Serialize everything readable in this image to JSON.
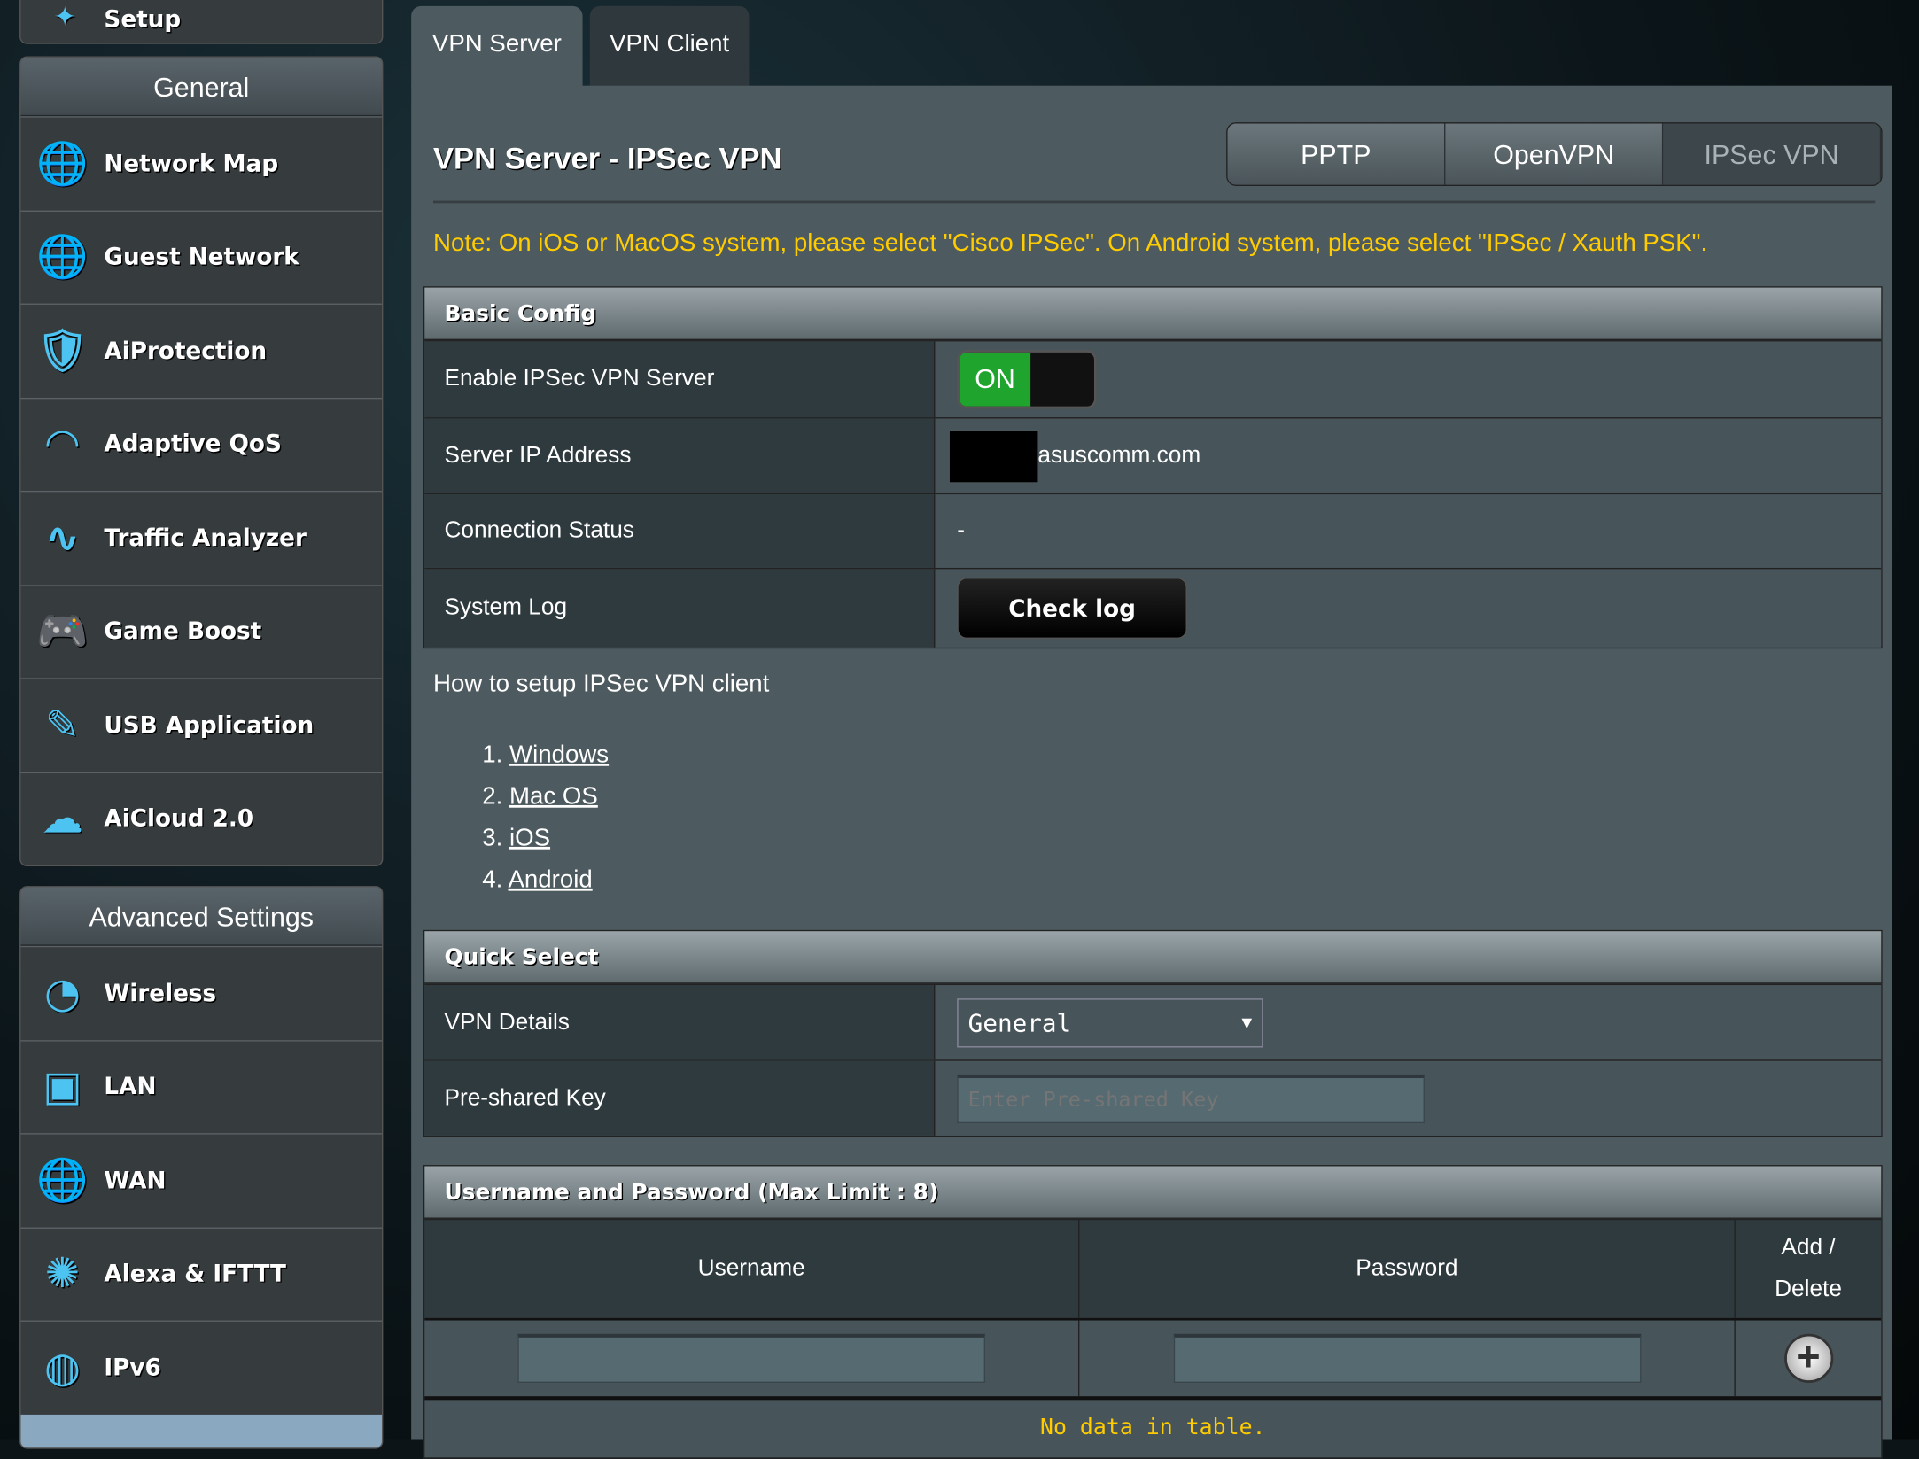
{
  "sidebar": {
    "top_item": "Setup",
    "general": {
      "header": "General",
      "items": [
        {
          "label": "Network Map",
          "icon": "globe-pin-icon"
        },
        {
          "label": "Guest Network",
          "icon": "guest-network-icon"
        },
        {
          "label": "AiProtection",
          "icon": "shield-lock-icon"
        },
        {
          "label": "Adaptive QoS",
          "icon": "speedometer-icon"
        },
        {
          "label": "Traffic Analyzer",
          "icon": "traffic-wave-icon"
        },
        {
          "label": "Game Boost",
          "icon": "gamepad-icon"
        },
        {
          "label": "USB Application",
          "icon": "usb-icon"
        },
        {
          "label": "AiCloud 2.0",
          "icon": "cloud-icon"
        }
      ]
    },
    "advanced": {
      "header": "Advanced Settings",
      "items": [
        {
          "label": "Wireless",
          "icon": "wireless-icon"
        },
        {
          "label": "LAN",
          "icon": "lan-icon"
        },
        {
          "label": "WAN",
          "icon": "globe-icon"
        },
        {
          "label": "Alexa & IFTTT",
          "icon": "alexa-icon"
        },
        {
          "label": "IPv6",
          "icon": "ipv6-icon"
        }
      ]
    }
  },
  "tabs": [
    {
      "label": "VPN Server",
      "active": true
    },
    {
      "label": "VPN Client",
      "active": false
    }
  ],
  "main": {
    "title": "VPN Server - IPSec VPN",
    "protocols": [
      "PPTP",
      "OpenVPN",
      "IPSec VPN"
    ],
    "active_protocol": "IPSec VPN",
    "note": "Note: On iOS or MacOS system, please select \"Cisco IPSec\". On Android system, please select \"IPSec / Xauth PSK\".",
    "basic": {
      "header": "Basic Config",
      "enable_label": "Enable IPSec VPN Server",
      "toggle": "ON",
      "server_ip_label": "Server IP Address",
      "server_ip_suffix": "asuscomm.com",
      "status_label": "Connection Status",
      "status_value": "-",
      "log_label": "System Log",
      "log_button": "Check log"
    },
    "howto": {
      "title": "How to setup IPSec VPN client",
      "links": [
        "Windows",
        "Mac OS",
        "iOS",
        "Android"
      ]
    },
    "quick": {
      "header": "Quick Select",
      "details_label": "VPN Details",
      "details_value": "General",
      "psk_label": "Pre-shared Key",
      "psk_placeholder": "Enter Pre-shared Key"
    },
    "users": {
      "header": "Username and Password (Max Limit : 8)",
      "col_user": "Username",
      "col_pass": "Password",
      "col_add": "Add /",
      "col_delete": "Delete",
      "empty": "No data in table."
    }
  },
  "colors": {
    "note": "#ffcc00",
    "toggle_on": "#1fa52e",
    "icon": "#4cc3f0"
  }
}
